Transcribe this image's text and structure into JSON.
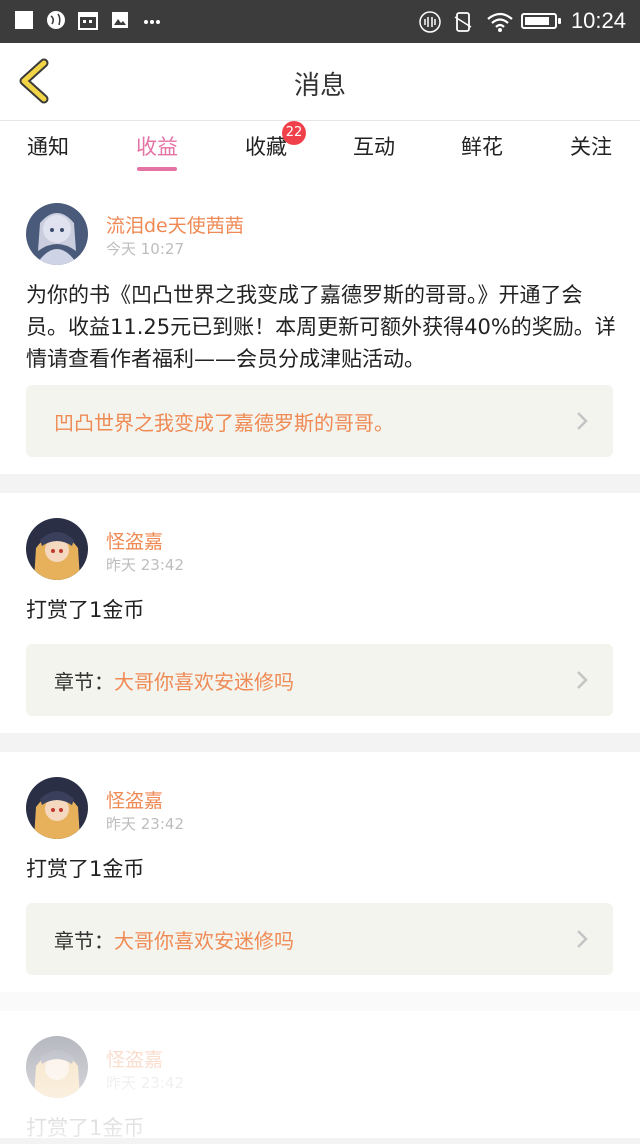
{
  "status_bar": {
    "time": "10:24",
    "battery_level": 0.85
  },
  "header": {
    "title": "消息"
  },
  "tabs": [
    {
      "label": "通知",
      "active": false
    },
    {
      "label": "收益",
      "active": true
    },
    {
      "label": "收藏",
      "active": false,
      "badge": "22"
    },
    {
      "label": "互动",
      "active": false
    },
    {
      "label": "鲜花",
      "active": false
    },
    {
      "label": "关注",
      "active": false
    }
  ],
  "messages": [
    {
      "user": "流泪de天使茜茜",
      "time": "今天 10:27",
      "text": "为你的书《凹凸世界之我变成了嘉德罗斯的哥哥。》开通了会员。收益11.25元已到账！本周更新可额外获得40%的奖励。详情请查看作者福利——会员分成津贴活动。",
      "link_prefix": "",
      "link_text": "凹凸世界之我变成了嘉德罗斯的哥哥。"
    },
    {
      "user": "怪盗嘉",
      "time": "昨天 23:42",
      "text": "打赏了1金币",
      "link_prefix": "章节：",
      "link_text": "大哥你喜欢安迷修吗"
    },
    {
      "user": "怪盗嘉",
      "time": "昨天 23:42",
      "text": "打赏了1金币",
      "link_prefix": "章节：",
      "link_text": "大哥你喜欢安迷修吗"
    },
    {
      "user": "怪盗嘉",
      "time": "昨天 23:42",
      "text": "打赏了1金币"
    }
  ],
  "colors": {
    "accent": "#e573a3",
    "username": "#ef8a55",
    "badge": "#f0414b",
    "back_arrow": "#f2d447"
  }
}
